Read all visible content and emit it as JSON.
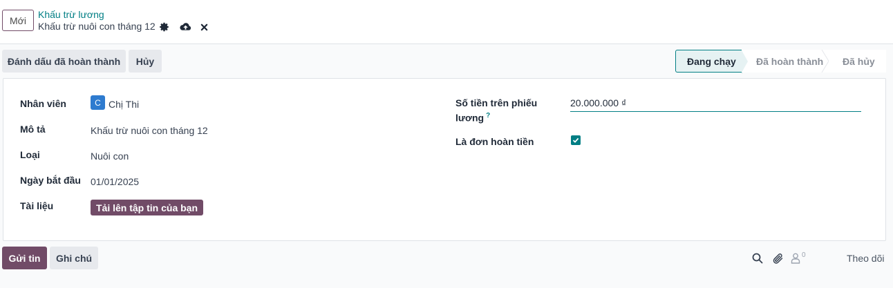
{
  "topbar": {
    "new_label": "Mới",
    "breadcrumb": "Khấu trừ lương",
    "record_title": "Khấu trừ nuôi con tháng 12"
  },
  "actions": {
    "mark_done": "Đánh dấu đã hoàn thành",
    "cancel": "Hủy"
  },
  "stages": [
    {
      "label": "Đang chạy",
      "active": true
    },
    {
      "label": "Đã hoàn thành",
      "active": false
    },
    {
      "label": "Đã hủy",
      "active": false
    }
  ],
  "form": {
    "employee_label": "Nhân viên",
    "employee_initial": "C",
    "employee_value": "Chị Thi",
    "description_label": "Mô tả",
    "description_value": "Khấu trừ  nuôi con tháng 12",
    "type_label": "Loại",
    "type_value": "Nuôi con",
    "start_date_label": "Ngày bắt đầu",
    "start_date_value": "01/01/2025",
    "document_label": "Tài liệu",
    "upload_label": "Tải lên tập tin của bạn",
    "amount_label_1": "Số tiền trên phiếu",
    "amount_label_2": "lương",
    "amount_help": "?",
    "amount_value": "20.000.000 ₫",
    "refund_label": "Là đơn hoàn tiền",
    "refund_checked": true
  },
  "chatter": {
    "send_label": "Gửi tin",
    "note_label": "Ghi chú",
    "follower_count": "0",
    "follow_label": "Theo dõi"
  },
  "colors": {
    "brand": "#714B67",
    "accent": "#017e84"
  }
}
